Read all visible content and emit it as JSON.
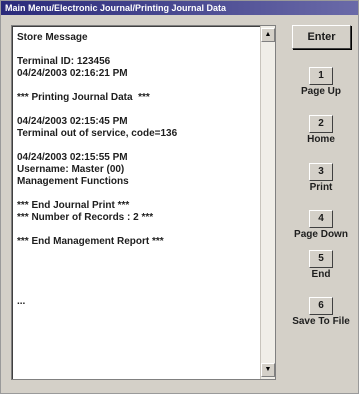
{
  "window": {
    "title": "Main Menu/Electronic Journal/Printing Journal Data"
  },
  "journal": {
    "lines": [
      "Store Message",
      "",
      "Terminal ID: 123456",
      "04/24/2003 02:16:21 PM",
      "",
      "*** Printing Journal Data  ***",
      "",
      "04/24/2003 02:15:45 PM",
      "Terminal out of service, code=136",
      "",
      "04/24/2003 02:15:55 PM",
      "Username: Master (00)",
      "Management Functions",
      "",
      "*** End Journal Print ***",
      "*** Number of Records : 2 ***",
      "",
      "*** End Management Report ***",
      "",
      "",
      "",
      "",
      "...",
      ""
    ]
  },
  "scrollbar": {
    "up_icon": "scroll-up-arrow",
    "down_icon": "scroll-down-arrow"
  },
  "buttons": {
    "enter": "Enter",
    "keys": [
      {
        "num": "1",
        "label": "Page Up"
      },
      {
        "num": "2",
        "label": "Home"
      },
      {
        "num": "3",
        "label": "Print"
      },
      {
        "num": "4",
        "label": "Page Down"
      },
      {
        "num": "5",
        "label": "End"
      },
      {
        "num": "6",
        "label": "Save To File"
      }
    ]
  }
}
